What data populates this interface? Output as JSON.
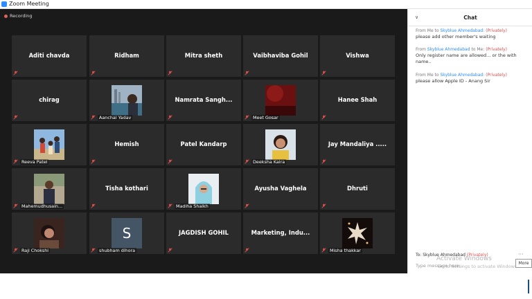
{
  "window": {
    "title": "Zoom Meeting"
  },
  "recording": {
    "label": "Recording"
  },
  "tiles": [
    {
      "name": "Aditi chavda"
    },
    {
      "name": "Ridham"
    },
    {
      "name": "Mitra sheth"
    },
    {
      "name": "Vaibhaviba Gohil"
    },
    {
      "name": "Vishwa"
    },
    {
      "name": "chirag"
    },
    {
      "label": "Aanchal Yadav"
    },
    {
      "name": "Namrata  Sangh..."
    },
    {
      "label": "Meet Gosar"
    },
    {
      "name": "Hanee Shah"
    },
    {
      "label": "Reeva Patel"
    },
    {
      "name": "Hemish"
    },
    {
      "name": "Patel Kandarp"
    },
    {
      "label": "Deeksha Kalra"
    },
    {
      "name": "Jay  Mandaliya  ....."
    },
    {
      "label": "Mahemudhusain..."
    },
    {
      "name": "Tisha kothari"
    },
    {
      "label": "Madiha Shaikh"
    },
    {
      "name": "Ayusha Vaghela"
    },
    {
      "name": "Dhruti"
    },
    {
      "label": "Raji Chokshi"
    },
    {
      "label": "shubham dihora",
      "initial": "S"
    },
    {
      "name": "JAGDISH GOHIL"
    },
    {
      "name": "Marketing,  Indu..."
    },
    {
      "label": "Misha thakkar"
    }
  ],
  "chat": {
    "title": "Chat",
    "messages": [
      {
        "from_prefix": "From Me to",
        "from_name": "Skyblue Ahmedabad:",
        "privately": "(Privately)",
        "text": "please add other member's waiting"
      },
      {
        "from_prefix": "From",
        "from_name": "Skyblue Ahmedabad",
        "to_suffix": "to Me:",
        "privately": "(Privately)",
        "text": "Only register name are allowed... or the with name.."
      },
      {
        "from_prefix": "From Me to",
        "from_name": "Skyblue Ahmedabad:",
        "privately": "(Privately)",
        "text": "please allow Apple ID - Anang Sir"
      }
    ],
    "to_label": "To: Skyblue Ahmedabad",
    "to_privately": "(Privately)",
    "placeholder": "Type message here...",
    "more_tooltip": "More",
    "more_dots": "···"
  },
  "watermark": {
    "line1": "Activate Windows",
    "line2": "Go to Settings to activate Windows."
  },
  "colors": {
    "accent": "#2d8cff",
    "private": "#e05050",
    "tile_bg": "#2b2b2b",
    "video_bg": "#1a1a1a"
  }
}
